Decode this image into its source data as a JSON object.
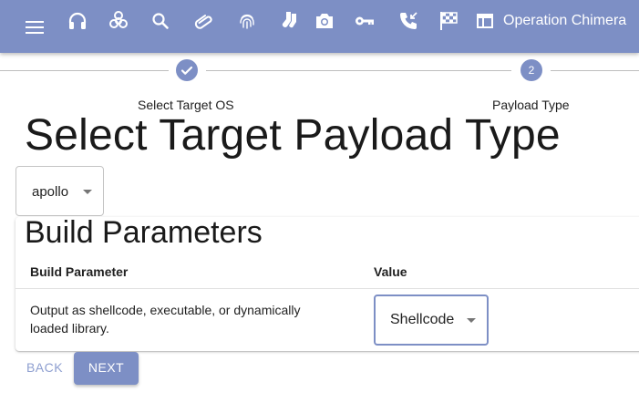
{
  "colors": {
    "primary": "#7d8fc5",
    "text": "#212121",
    "back_text": "#8e9fd0"
  },
  "appbar": {
    "icons": [
      "headset-icon",
      "biohazard-icon",
      "search-icon",
      "paperclip-icon",
      "fingerprint-icon",
      "socks-icon",
      "camera-icon",
      "key-icon",
      "phone-callback-icon",
      "checkered-flag-icon",
      "table-icon"
    ],
    "operation_name": "Operation Chimera"
  },
  "stepper": {
    "step1": {
      "label": "Select Target OS",
      "state": "completed"
    },
    "step2": {
      "number": "2",
      "label": "Payload Type",
      "state": "active"
    }
  },
  "page": {
    "title": "Select Target Payload Type"
  },
  "os_select": {
    "value": "apollo"
  },
  "build_parameters": {
    "title": "Build Parameters",
    "headers": {
      "parameter": "Build Parameter",
      "value": "Value"
    },
    "rows": [
      {
        "description": "Output as shellcode, executable, or dynamically loaded library.",
        "value": "Shellcode"
      }
    ]
  },
  "buttons": {
    "back": "BACK",
    "next": "NEXT"
  }
}
